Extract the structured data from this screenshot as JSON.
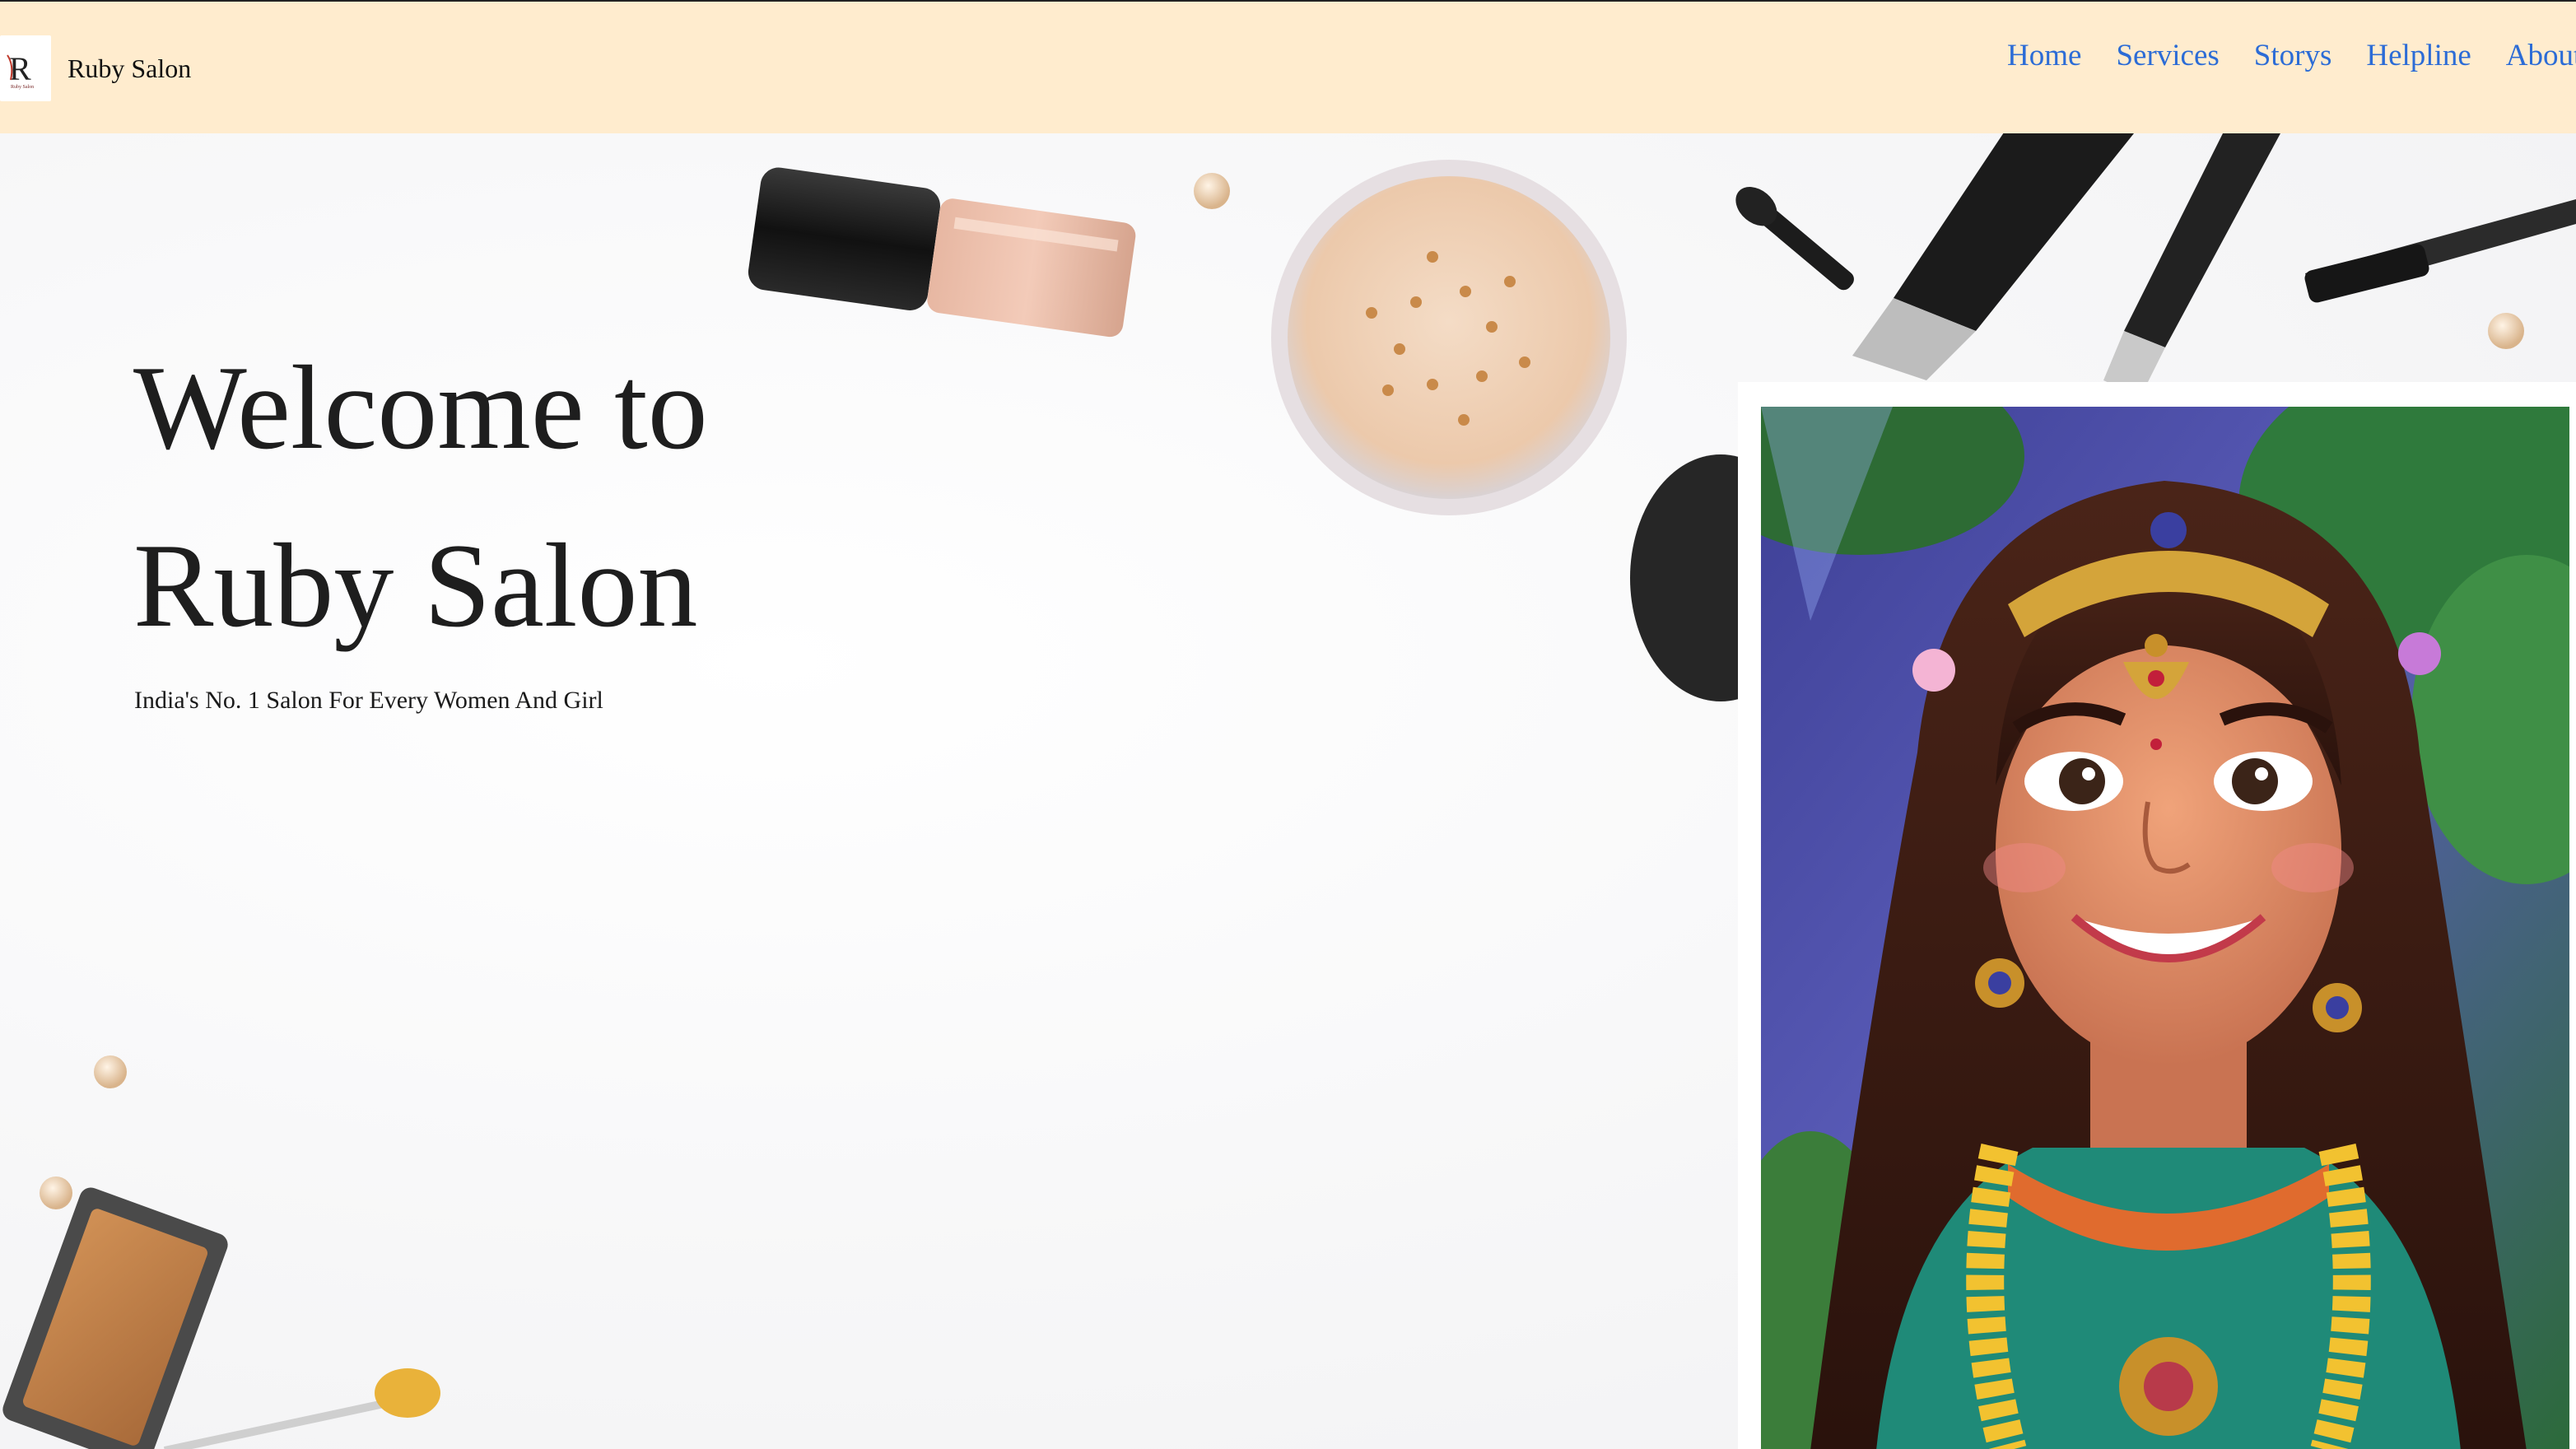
{
  "brand": {
    "name": "Ruby Salon",
    "logo_icon": "ruby-salon-logo-icon"
  },
  "nav": {
    "links": [
      "Home",
      "Services",
      "Storys",
      "Helpline",
      "About"
    ]
  },
  "hero": {
    "title_line1": "Welcome to",
    "title_line2": "Ruby Salon",
    "subtitle": "India's No. 1 Salon For Every Women And Girl",
    "background_image": "makeup-products-flatlay",
    "portrait_image": "smiling-woman-illustration"
  },
  "colors": {
    "navbar_bg": "#ffecce",
    "nav_link": "#2c6cd6",
    "title": "#1e1e1e",
    "portrait_frame": "#ffffff"
  }
}
